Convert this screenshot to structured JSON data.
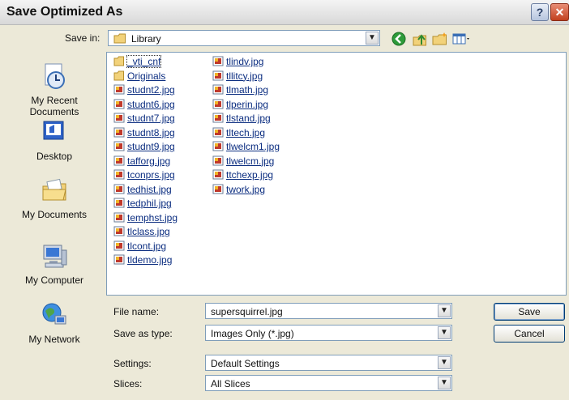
{
  "window": {
    "title": "Save Optimized As"
  },
  "toolbar": {
    "save_in_label": "Save in:",
    "save_in_value": "Library",
    "icons": [
      "back-icon",
      "up-folder-icon",
      "new-folder-icon",
      "views-icon"
    ]
  },
  "places": [
    {
      "label_1": "My Recent",
      "label_2": "Documents",
      "icon": "recent-icon"
    },
    {
      "label_1": "Desktop",
      "icon": "desktop-icon"
    },
    {
      "label_1": "My Documents",
      "icon": "my-documents-icon"
    },
    {
      "label_1": "My Computer",
      "icon": "computer-icon"
    },
    {
      "label_1": "My Network",
      "icon": "network-icon"
    }
  ],
  "files": {
    "column_1": [
      "_vti_cnf",
      "Originals",
      "studnt2.jpg",
      "studnt6.jpg",
      "studnt7.jpg",
      "studnt8.jpg",
      "studnt9.jpg",
      "tafforg.jpg",
      "tconprs.jpg",
      "tedhist.jpg",
      "tedphil.jpg",
      "temphst.jpg",
      "tlclass.jpg",
      "tlcont.jpg",
      "tldemo.jpg"
    ],
    "column_2": [
      "tlindv.jpg",
      "tllitcy.jpg",
      "tlmath.jpg",
      "tlperin.jpg",
      "tlstand.jpg",
      "tltech.jpg",
      "tlwelcm1.jpg",
      "tlwelcm.jpg",
      "ttchexp.jpg",
      "twork.jpg"
    ]
  },
  "form": {
    "file_name_label": "File name:",
    "file_name_value": "supersquirrel.jpg",
    "save_type_label": "Save as type:",
    "save_type_value": "Images Only (*.jpg)",
    "settings_label": "Settings:",
    "settings_value": "Default Settings",
    "slices_label": "Slices:",
    "slices_value": "All Slices"
  },
  "buttons": {
    "save": "Save",
    "cancel": "Cancel"
  },
  "colors": {
    "accent": "#0b2d80",
    "close": "#c2401e",
    "background": "#ece9d8"
  }
}
